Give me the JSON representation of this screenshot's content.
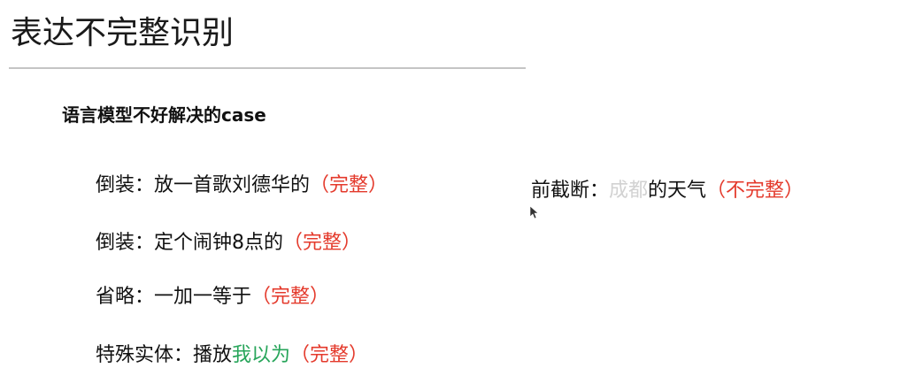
{
  "title": "表达不完整识别",
  "subheading": "语言模型不好解决的case",
  "examples": [
    {
      "label": "倒装：",
      "text": "放一首歌刘德华的",
      "tag": "（完整）"
    },
    {
      "label": "倒装：",
      "text": "定个闹钟8点的",
      "tag": "（完整）"
    },
    {
      "label": "省略：",
      "text": "一加一等于",
      "tag": "（完整）"
    },
    {
      "label": "特殊实体：",
      "text": "播放",
      "highlight": "我以为",
      "tag": "（完整）"
    },
    {
      "label": "前截断：",
      "faded": "成都",
      "text": "的天气",
      "tag": "（不完整）"
    }
  ],
  "colors": {
    "tag": "#e43a2c",
    "entity_highlight": "#27a55a",
    "faded_text": "#d2d2d2"
  }
}
